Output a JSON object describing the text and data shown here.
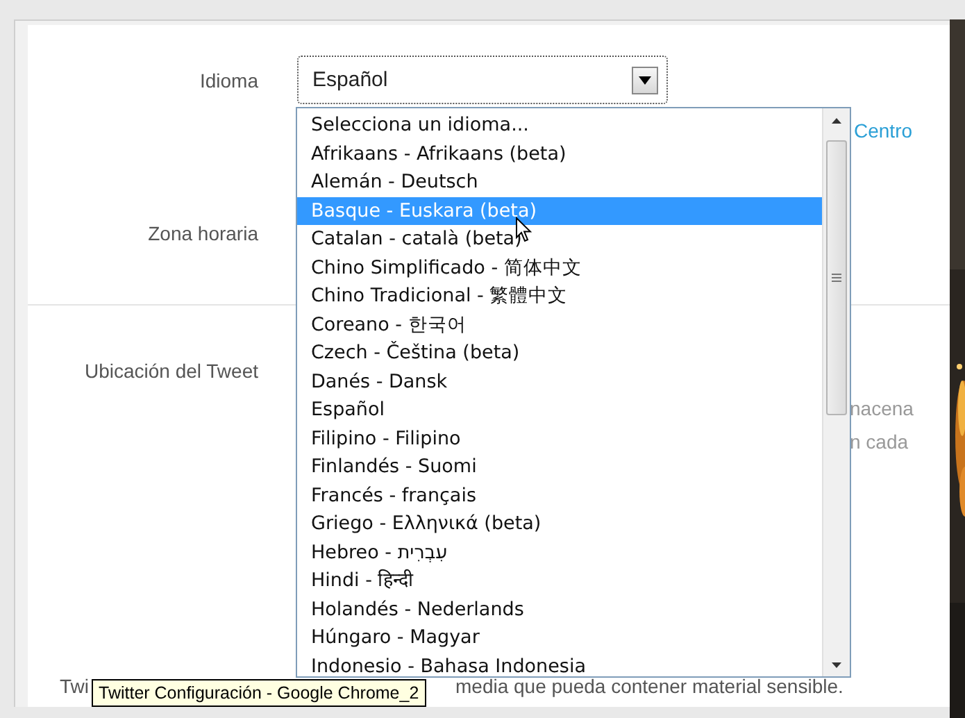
{
  "form": {
    "language": {
      "label": "Idioma",
      "value": "Español"
    },
    "timezone": {
      "label": "Zona horaria"
    },
    "location": {
      "label": "Ubicación del Tweet"
    },
    "link_fragment": "Centro",
    "location_fragments": [
      "nacena",
      "n cada"
    ],
    "media_text_start": "Twi",
    "media_text_end": "media que pueda contener material sensible."
  },
  "dropdown": {
    "options": [
      {
        "label": "Selecciona un idioma...",
        "selected": false
      },
      {
        "label": "Afrikaans - Afrikaans (beta)",
        "selected": false
      },
      {
        "label": "Alemán - Deutsch",
        "selected": false
      },
      {
        "label": "Basque - Euskara (beta)",
        "selected": true
      },
      {
        "label": "Catalan - català (beta)",
        "selected": false
      },
      {
        "label": "Chino Simplificado - 简体中文",
        "selected": false
      },
      {
        "label": "Chino Tradicional - 繁體中文",
        "selected": false
      },
      {
        "label": "Coreano - 한국어",
        "selected": false
      },
      {
        "label": "Czech - Čeština (beta)",
        "selected": false
      },
      {
        "label": "Danés - Dansk",
        "selected": false
      },
      {
        "label": "Español",
        "selected": false
      },
      {
        "label": "Filipino - Filipino",
        "selected": false
      },
      {
        "label": "Finlandés - Suomi",
        "selected": false
      },
      {
        "label": "Francés - français",
        "selected": false
      },
      {
        "label": "Griego - Ελληνικά (beta)",
        "selected": false
      },
      {
        "label": "Hebreo - עִבְרִית",
        "selected": false
      },
      {
        "label": "Hindi - हिन्दी",
        "selected": false
      },
      {
        "label": "Holandés - Nederlands",
        "selected": false
      },
      {
        "label": "Húngaro - Magyar",
        "selected": false
      },
      {
        "label": "Indonesio - Bahasa Indonesia",
        "selected": false
      }
    ]
  },
  "tooltip": "Twitter  Configuración - Google Chrome_2"
}
